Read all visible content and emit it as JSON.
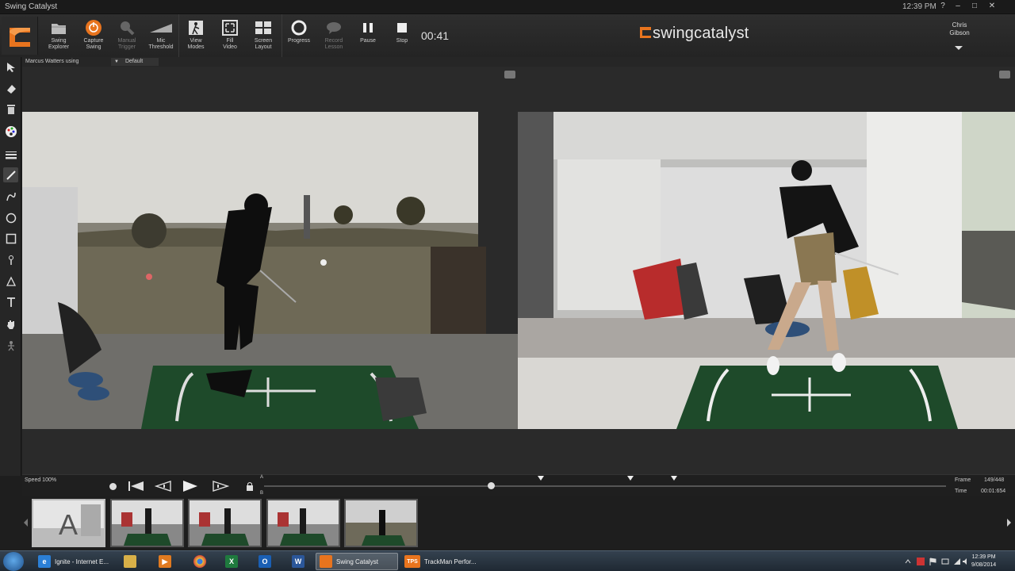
{
  "window": {
    "title": "Swing Catalyst",
    "clock": "12:39 PM",
    "help": "?",
    "minimize": "–",
    "maximize": "□",
    "close": "✕"
  },
  "toolbar": {
    "buttons": [
      {
        "id": "swing-explorer",
        "line1": "Swing",
        "line2": "Explorer",
        "icon": "folder-icon",
        "enabled": true
      },
      {
        "id": "capture-swing",
        "line1": "Capture",
        "line2": "Swing",
        "icon": "power-icon",
        "enabled": true
      },
      {
        "id": "manual-trigger",
        "line1": "Manual",
        "line2": "Trigger",
        "icon": "trigger-icon",
        "enabled": false
      },
      {
        "id": "mic-threshold",
        "line1": "Mic",
        "line2": "Threshold",
        "icon": "ramp-icon",
        "enabled": true
      },
      {
        "id": "view-modes",
        "line1": "View",
        "line2": "Modes",
        "icon": "golfer-icon",
        "enabled": true
      },
      {
        "id": "fill-video",
        "line1": "Fill",
        "line2": "Video",
        "icon": "fill-icon",
        "enabled": true
      },
      {
        "id": "screen-layout",
        "line1": "Screen",
        "line2": "Layout",
        "icon": "grid-icon",
        "enabled": true
      },
      {
        "id": "progress",
        "line1": "Progress",
        "line2": "",
        "icon": "ring-icon",
        "enabled": true
      },
      {
        "id": "record-lesson",
        "line1": "Record",
        "line2": "Lesson",
        "icon": "speech-icon",
        "enabled": false
      },
      {
        "id": "pause",
        "line1": "Pause",
        "line2": "",
        "icon": "pause-icon",
        "enabled": true
      },
      {
        "id": "stop",
        "line1": "Stop",
        "line2": "",
        "icon": "stop-icon",
        "enabled": true
      }
    ],
    "timer": "00:41",
    "brand": "swingcatalyst",
    "user_first": "Chris",
    "user_last": "Gibson"
  },
  "subbar": {
    "user_label": "Marcus Watters using",
    "layout_value": "Default"
  },
  "playback": {
    "speed_label": "Speed 100%",
    "a_label": "A",
    "b_label": "B",
    "frame_label": "Frame",
    "frame_value": "149/448",
    "time_label": "Time",
    "time_value": "00:01:654",
    "position_fraction": 0.333
  },
  "thumbnails": {
    "first_letter": "A"
  },
  "taskbar": {
    "apps": [
      {
        "label": "Ignite - Internet E...",
        "icon": "ie-icon"
      },
      {
        "label": "Swing Catalyst",
        "icon": "swingcatalyst-icon"
      },
      {
        "label": "TrackMan Perfor...",
        "icon": "tps-icon",
        "icon_text": "TPS"
      }
    ],
    "clock_time": "12:39 PM",
    "clock_date": "9/08/2014"
  },
  "colors": {
    "accent_orange": "#e8741e",
    "mat_green": "#1e4a2a"
  }
}
